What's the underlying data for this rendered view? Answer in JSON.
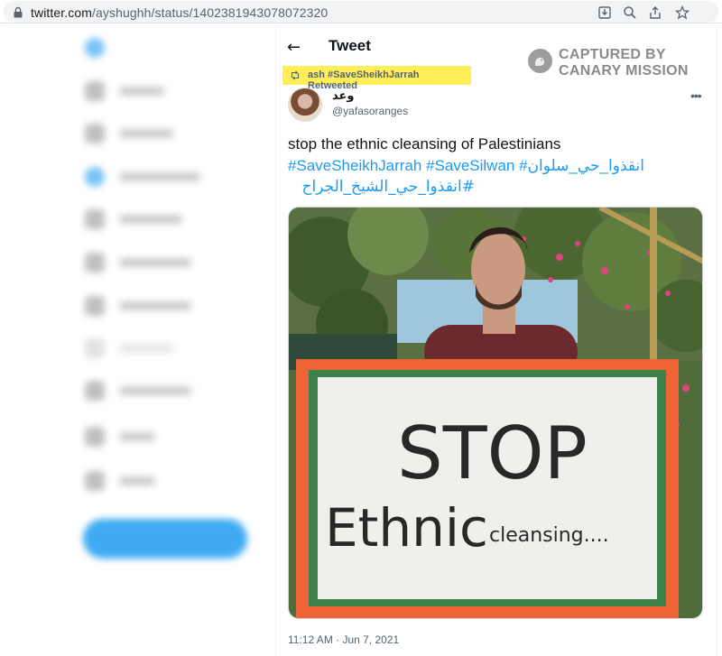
{
  "browser": {
    "url_host": "twitter.com",
    "url_path": "/ayshughh/status/1402381943078072320"
  },
  "tweet_page": {
    "header_title": "Tweet",
    "watermark_text_line1": "CAPTURED BY",
    "watermark_text_line2": "CANARY MISSION",
    "retweet_context": "ash #SaveSheikhJarrah Retweeted",
    "author_name": "وعد",
    "author_handle": "@yafasoranges",
    "text_line1": "stop the ethnic cleansing of Palestinians",
    "text_line2": "#SaveSheikhJarrah #SaveSilwan #انقذوا_حي_سلوان",
    "text_line3": "#انقذوا_حي_الشيخ_الجراح",
    "sign_line1": "STOP",
    "sign_line2": "Ethnic",
    "sign_line3": "cleansing....",
    "timestamp": "11:12 AM · Jun 7, 2021"
  },
  "colors": {
    "link": "#1d9bf0",
    "highlight": "#ffee58",
    "sign_orange": "#f05a28",
    "sign_green": "#2f7a3e"
  },
  "icons": [
    "lock-icon",
    "install-icon",
    "zoom-icon",
    "share-icon",
    "star-icon",
    "back-arrow-icon",
    "retweet-icon",
    "more-icon"
  ]
}
